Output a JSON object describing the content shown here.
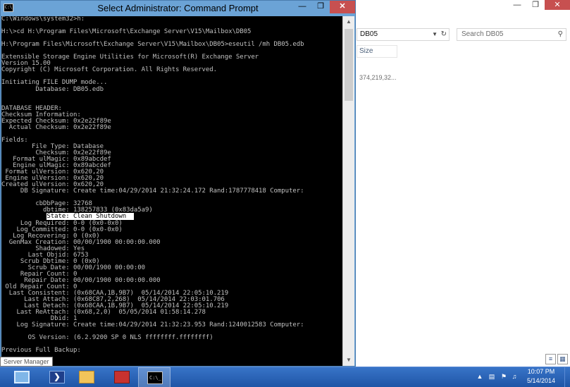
{
  "explorer": {
    "address": "DB05",
    "search_placeholder": "Search DB05",
    "column_size": "Size",
    "cell_value": "374,219,32..."
  },
  "cmd": {
    "title": "Select Administrator: Command Prompt",
    "lines": [
      "C:\\Windows\\system32>h:",
      "",
      "H:\\>cd H:\\Program Files\\Microsoft\\Exchange Server\\V15\\Mailbox\\DB05",
      "",
      "H:\\Program Files\\Microsoft\\Exchange Server\\V15\\Mailbox\\DB05>eseutil /mh DB05.edb",
      "",
      "Extensible Storage Engine Utilities for Microsoft(R) Exchange Server",
      "Version 15.00",
      "Copyright (C) Microsoft Corporation. All Rights Reserved.",
      "",
      "Initiating FILE DUMP mode...",
      "         Database: DB05.edb",
      "",
      "",
      "DATABASE HEADER:",
      "Checksum Information:",
      "Expected Checksum: 0x2e22f89e",
      "  Actual Checksum: 0x2e22f89e",
      "",
      "Fields:",
      "        File Type: Database",
      "         Checksum: 0x2e22f89e",
      "   Format ulMagic: 0x89abcdef",
      "   Engine ulMagic: 0x89abcdef",
      " Format ulVersion: 0x620,20",
      " Engine ulVersion: 0x620,20",
      "Created ulVersion: 0x620,20",
      "     DB Signature: Create time:04/29/2014 21:32:24.172 Rand:1787778418 Computer:",
      "",
      "         cbDbPage: 32768",
      "           dbtime: 138257833 (0x83da5a9)",
      "            State: Clean Shutdown",
      "     Log Required: 0-0 (0x0-0x0)",
      "    Log Committed: 0-0 (0x0-0x0)",
      "   Log Recovering: 0 (0x0)",
      "  GenMax Creation: 00/00/1900 00:00:00.000",
      "         Shadowed: Yes",
      "       Last Objid: 6753",
      "     Scrub Dbtime: 0 (0x0)",
      "       Scrub Date: 00/00/1900 00:00:00",
      "     Repair Count: 0",
      "      Repair Date: 00/00/1900 00:00:00.000",
      " Old Repair Count: 0",
      "  Last Consistent: (0x68CAA,1B,9B7)  05/14/2014 22:05:10.219",
      "      Last Attach: (0x68C87,2,268)  05/14/2014 22:03:01.706",
      "      Last Detach: (0x68CAA,1B,9B7)  05/14/2014 22:05:10.219",
      "    Last ReAttach: (0x68,2,0)  05/05/2014 01:58:14.278",
      "             Dbid: 1",
      "    Log Signature: Create time:04/29/2014 21:32:23.953 Rand:1240012583 Computer:",
      "",
      "       OS Version: (6.2.9200 SP 0 NLS ffffffff.ffffffff)",
      "",
      "Previous Full Backup:"
    ],
    "highlighted_line": 31
  },
  "tooltip": "Server Manager",
  "taskbar": {
    "items": [
      "Server Manager",
      "Windows PowerShell",
      "File Explorer",
      "Exchange Toolbox",
      "Command Prompt"
    ],
    "time": "10:07 PM",
    "date": "5/14/2014"
  }
}
